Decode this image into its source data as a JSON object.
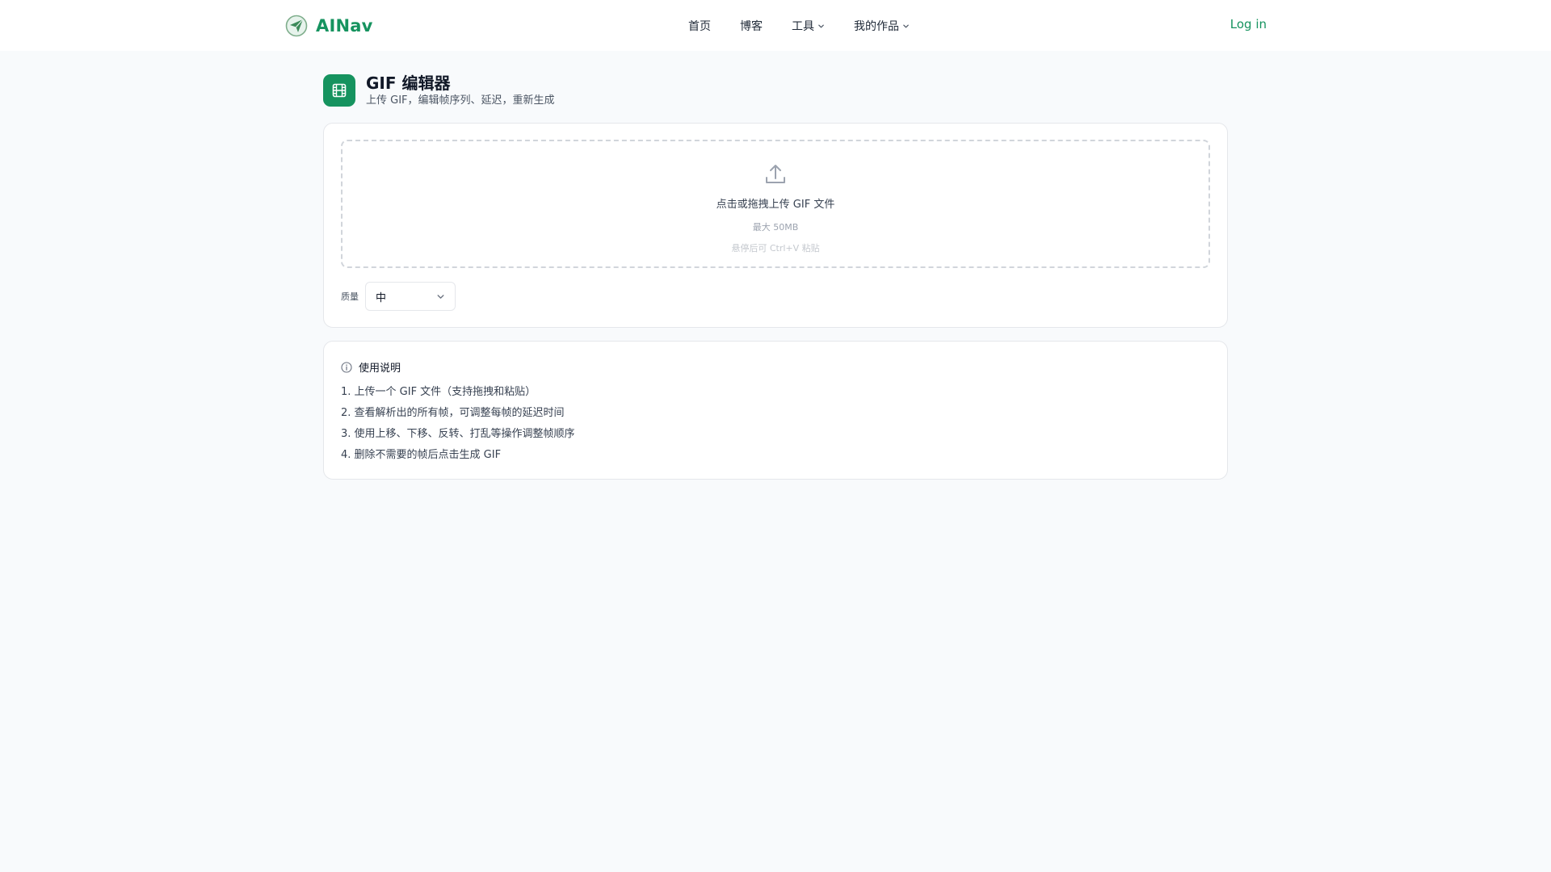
{
  "header": {
    "brand": "AINav",
    "nav": [
      {
        "label": "首页"
      },
      {
        "label": "博客"
      },
      {
        "label": "工具"
      },
      {
        "label": "我的作品"
      }
    ],
    "login": "Log in"
  },
  "page": {
    "title": "GIF 编辑器",
    "subtitle": "上传 GIF，编辑帧序列、延迟，重新生成"
  },
  "upload": {
    "main": "点击或拖拽上传 GIF 文件",
    "max": "最大 50MB",
    "paste": "悬停后可 Ctrl+V 粘贴"
  },
  "quality": {
    "label": "质量",
    "value": "中"
  },
  "help": {
    "title": "使用说明",
    "steps": [
      "1. 上传一个 GIF 文件（支持拖拽和粘贴）",
      "2. 查看解析出的所有帧，可调整每帧的延迟时间",
      "3. 使用上移、下移、反转、打乱等操作调整帧顺序",
      "4. 删除不需要的帧后点击生成 GIF"
    ]
  },
  "colors": {
    "brand": "#16935f",
    "background": "#f8fafc",
    "card": "#ffffff",
    "border": "#e5e7eb"
  }
}
